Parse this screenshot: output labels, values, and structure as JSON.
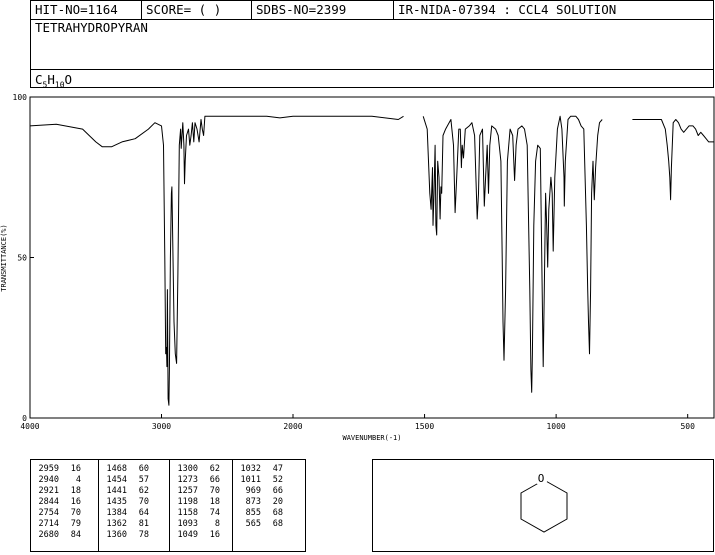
{
  "header": {
    "hit_no": "HIT-NO=1164",
    "score": "SCORE=  (   )",
    "sdbs_no": "SDBS-NO=2399",
    "ir_no": "IR-NIDA-07394 : CCL4 SOLUTION",
    "compound_name": "TETRAHYDROPYRAN",
    "formula_parts": [
      "C",
      "5",
      "H",
      "10",
      "O"
    ]
  },
  "chart_data": {
    "type": "line",
    "title": "",
    "xlabel": "WAVENUMBER(-1)",
    "ylabel": "TRANSMITTANCE(%)",
    "xlim": [
      4000,
      400
    ],
    "ylim": [
      0,
      100
    ],
    "x_ticks": [
      "4000",
      "3000",
      "2000",
      "1500",
      "1000",
      "500"
    ],
    "x_tick_values": [
      4000,
      3000,
      2000,
      1500,
      1000,
      500
    ],
    "y_ticks": [
      "0",
      "50",
      "100"
    ],
    "y_tick_values": [
      0,
      50,
      100
    ],
    "series": [
      {
        "segments": [
          [
            [
              4000,
              91
            ],
            [
              3800,
              91.5
            ],
            [
              3600,
              90
            ],
            [
              3500,
              86
            ],
            [
              3450,
              84.5
            ],
            [
              3380,
              84.5
            ],
            [
              3300,
              86
            ],
            [
              3200,
              87
            ],
            [
              3100,
              90
            ],
            [
              3050,
              92
            ],
            [
              3000,
              91
            ],
            [
              2985,
              85
            ],
            [
              2975,
              50
            ],
            [
              2968,
              20
            ],
            [
              2962,
              22
            ],
            [
              2959,
              16
            ],
            [
              2955,
              40
            ],
            [
              2950,
              6
            ],
            [
              2944,
              4
            ],
            [
              2940,
              15
            ],
            [
              2932,
              50
            ],
            [
              2925,
              70
            ],
            [
              2921,
              72
            ],
            [
              2916,
              60
            ],
            [
              2905,
              30
            ],
            [
              2895,
              20
            ],
            [
              2885,
              17
            ],
            [
              2875,
              45
            ],
            [
              2865,
              85
            ],
            [
              2855,
              90
            ],
            [
              2850,
              84
            ],
            [
              2844,
              88
            ],
            [
              2838,
              92
            ],
            [
              2830,
              85
            ],
            [
              2825,
              73
            ],
            [
              2820,
              80
            ],
            [
              2810,
              88
            ],
            [
              2795,
              90
            ],
            [
              2785,
              85
            ],
            [
              2775,
              88
            ],
            [
              2765,
              92
            ],
            [
              2754,
              86
            ],
            [
              2745,
              92
            ],
            [
              2730,
              90
            ],
            [
              2714,
              86
            ],
            [
              2700,
              93
            ],
            [
              2690,
              90
            ],
            [
              2680,
              88
            ],
            [
              2670,
              94
            ],
            [
              2600,
              94
            ],
            [
              2500,
              94
            ],
            [
              2400,
              94
            ],
            [
              2300,
              94
            ],
            [
              2200,
              94
            ],
            [
              2100,
              93.5
            ],
            [
              2000,
              94
            ],
            [
              1900,
              94
            ],
            [
              1800,
              94
            ],
            [
              1700,
              94
            ],
            [
              1600,
              93
            ],
            [
              1580,
              94
            ]
          ],
          [
            [
              1505,
              94
            ],
            [
              1490,
              90
            ],
            [
              1480,
              70
            ],
            [
              1475,
              65
            ],
            [
              1470,
              78
            ],
            [
              1468,
              60
            ],
            [
              1464,
              70
            ],
            [
              1460,
              85
            ],
            [
              1457,
              60
            ],
            [
              1454,
              57
            ],
            [
              1450,
              80
            ],
            [
              1445,
              75
            ],
            [
              1441,
              62
            ],
            [
              1438,
              72
            ],
            [
              1435,
              70
            ],
            [
              1430,
              88
            ],
            [
              1420,
              90
            ],
            [
              1400,
              93
            ],
            [
              1390,
              85
            ],
            [
              1384,
              64
            ],
            [
              1378,
              75
            ],
            [
              1370,
              90
            ],
            [
              1364,
              90
            ],
            [
              1360,
              78
            ],
            [
              1357,
              85
            ],
            [
              1352,
              81
            ],
            [
              1345,
              90
            ],
            [
              1330,
              91
            ],
            [
              1320,
              92
            ],
            [
              1310,
              88
            ],
            [
              1300,
              62
            ],
            [
              1295,
              70
            ],
            [
              1290,
              88
            ],
            [
              1280,
              90
            ],
            [
              1273,
              66
            ],
            [
              1268,
              75
            ],
            [
              1262,
              85
            ],
            [
              1257,
              70
            ],
            [
              1252,
              85
            ],
            [
              1245,
              91
            ],
            [
              1230,
              90
            ],
            [
              1220,
              88
            ],
            [
              1210,
              80
            ],
            [
              1205,
              50
            ],
            [
              1202,
              30
            ],
            [
              1198,
              18
            ],
            [
              1192,
              40
            ],
            [
              1185,
              80
            ],
            [
              1175,
              90
            ],
            [
              1165,
              88
            ],
            [
              1158,
              74
            ],
            [
              1152,
              85
            ],
            [
              1145,
              90
            ],
            [
              1130,
              91
            ],
            [
              1120,
              90
            ],
            [
              1110,
              85
            ],
            [
              1100,
              40
            ],
            [
              1096,
              15
            ],
            [
              1093,
              8
            ],
            [
              1090,
              20
            ],
            [
              1085,
              60
            ],
            [
              1078,
              80
            ],
            [
              1070,
              85
            ],
            [
              1060,
              84
            ],
            [
              1049,
              16
            ],
            [
              1045,
              40
            ],
            [
              1040,
              70
            ],
            [
              1036,
              60
            ],
            [
              1032,
              47
            ],
            [
              1028,
              65
            ],
            [
              1020,
              75
            ],
            [
              1015,
              70
            ],
            [
              1011,
              52
            ],
            [
              1005,
              75
            ],
            [
              995,
              90
            ],
            [
              985,
              94
            ],
            [
              978,
              90
            ],
            [
              970,
              75
            ],
            [
              969,
              66
            ],
            [
              965,
              80
            ],
            [
              955,
              93
            ],
            [
              945,
              94
            ],
            [
              935,
              94
            ],
            [
              925,
              94
            ],
            [
              915,
              93
            ],
            [
              905,
              91
            ],
            [
              895,
              90
            ],
            [
              885,
              60
            ],
            [
              880,
              40
            ],
            [
              877,
              30
            ],
            [
              873,
              20
            ],
            [
              869,
              40
            ],
            [
              865,
              70
            ],
            [
              860,
              80
            ],
            [
              855,
              68
            ],
            [
              850,
              78
            ],
            [
              842,
              88
            ],
            [
              835,
              92
            ],
            [
              825,
              93
            ]
          ],
          [
            [
              710,
              93
            ],
            [
              690,
              93
            ],
            [
              670,
              93
            ],
            [
              640,
              93
            ],
            [
              620,
              93
            ],
            [
              600,
              93
            ],
            [
              585,
              90
            ],
            [
              578,
              85
            ],
            [
              572,
              80
            ],
            [
              568,
              75
            ],
            [
              565,
              68
            ],
            [
              562,
              78
            ],
            [
              555,
              92
            ],
            [
              545,
              93
            ],
            [
              535,
              92
            ],
            [
              525,
              90
            ],
            [
              515,
              89
            ],
            [
              505,
              90
            ],
            [
              495,
              91
            ],
            [
              480,
              91
            ],
            [
              470,
              90
            ],
            [
              460,
              88
            ],
            [
              450,
              89
            ],
            [
              440,
              88
            ],
            [
              430,
              87
            ],
            [
              420,
              86
            ],
            [
              410,
              86
            ],
            [
              400,
              86
            ]
          ]
        ]
      }
    ],
    "peak_table": [
      [
        [
          "2959",
          "16"
        ],
        [
          "2940",
          "4"
        ],
        [
          "2921",
          "18"
        ],
        [
          "2844",
          "16"
        ],
        [
          "2754",
          "70"
        ],
        [
          "2714",
          "79"
        ],
        [
          "2680",
          "84"
        ]
      ],
      [
        [
          "1468",
          "60"
        ],
        [
          "1454",
          "57"
        ],
        [
          "1441",
          "62"
        ],
        [
          "1435",
          "70"
        ],
        [
          "1384",
          "64"
        ],
        [
          "1362",
          "81"
        ],
        [
          "1360",
          "78"
        ]
      ],
      [
        [
          "1300",
          "62"
        ],
        [
          "1273",
          "66"
        ],
        [
          "1257",
          "70"
        ],
        [
          "1198",
          "18"
        ],
        [
          "1158",
          "74"
        ],
        [
          "1093",
          "8"
        ],
        [
          "1049",
          "16"
        ]
      ],
      [
        [
          "1032",
          "47"
        ],
        [
          "1011",
          "52"
        ],
        [
          "969",
          "66"
        ],
        [
          "873",
          "20"
        ],
        [
          "855",
          "68"
        ],
        [
          "565",
          "68"
        ]
      ]
    ],
    "colors": {
      "line": "#000000",
      "background": "#ffffff"
    }
  },
  "structure": {
    "atom_label": "O"
  }
}
